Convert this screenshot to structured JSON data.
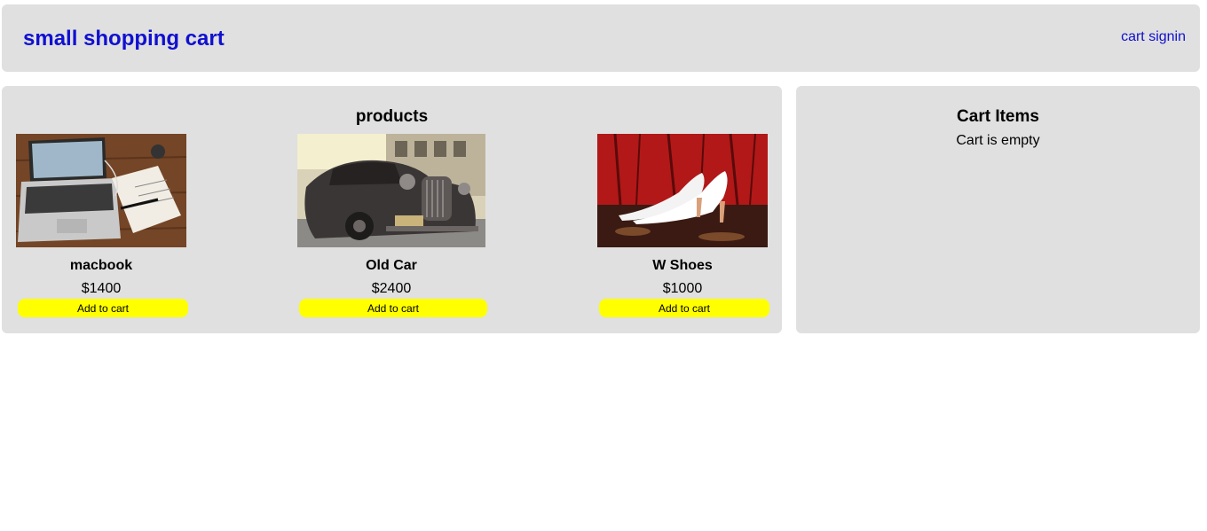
{
  "header": {
    "brand": "small shopping cart",
    "links": [
      "cart",
      "signin"
    ]
  },
  "products_panel": {
    "title": "products",
    "items": [
      {
        "name": "macbook",
        "price": "$1400",
        "button": "Add to cart",
        "image": "laptop-on-desk-photo"
      },
      {
        "name": "Old Car",
        "price": "$2400",
        "button": "Add to cart",
        "image": "vintage-car-photo"
      },
      {
        "name": "W Shoes",
        "price": "$1000",
        "button": "Add to cart",
        "image": "white-heels-photo"
      }
    ]
  },
  "cart_panel": {
    "title": "Cart Items",
    "empty_text": "Cart is empty"
  },
  "colors": {
    "panel_bg": "#e0e0e0",
    "link": "#1010d0",
    "button_bg": "#ffff00"
  }
}
